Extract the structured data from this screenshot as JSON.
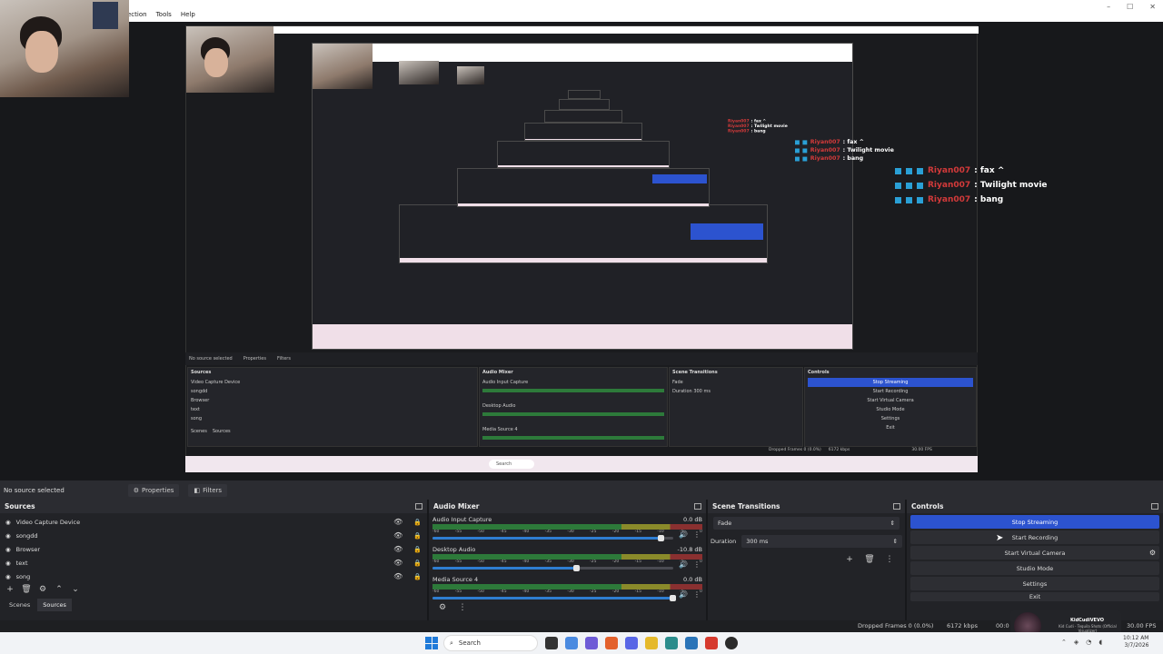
{
  "app": {
    "menu": [
      "ection",
      "Tools",
      "Help"
    ],
    "window_controls": [
      "–",
      "☐",
      "✕"
    ]
  },
  "preview": {
    "chat": [
      {
        "user": "Riyan007",
        "message": ": fax ^"
      },
      {
        "user": "Riyan007",
        "message": ": Twilight movie"
      },
      {
        "user": "Riyan007",
        "message": ": bang"
      }
    ],
    "inner": {
      "status": "No source selected",
      "properties": "Properties",
      "filters": "Filters",
      "sources_title": "Sources",
      "mixer_title": "Audio Mixer",
      "transitions_title": "Scene Transitions",
      "controls_title": "Controls",
      "sources": [
        "Video Capture Device",
        "songdd",
        "Browser",
        "text",
        "song"
      ],
      "stop_streaming": "Stop Streaming",
      "start_recording": "Start Recording",
      "virtual_camera": "Start Virtual Camera",
      "studio_mode": "Studio Mode",
      "settings": "Settings",
      "exit": "Exit",
      "fade": "Fade",
      "duration": "Duration",
      "duration_value": "300 ms",
      "scenes_tab": "Scenes",
      "sources_tab": "Sources",
      "mix_ch1": "Audio Input Capture",
      "mix_ch2": "Desktop Audio",
      "mix_ch3": "Media Source 4",
      "dropped": "Dropped Frames 0 (0.0%)",
      "kbps": "6172 kbps",
      "fps": "30.00 FPS",
      "search": "Search"
    }
  },
  "source_bar": {
    "label": "No source selected",
    "properties": "Properties",
    "filters": "Filters"
  },
  "sources": {
    "title": "Sources",
    "items": [
      "Video Capture Device",
      "songdd",
      "Browser",
      "text",
      "song"
    ],
    "tabs": [
      "Scenes",
      "Sources"
    ]
  },
  "mixer": {
    "title": "Audio Mixer",
    "ticks": [
      "-60",
      "-55",
      "-50",
      "-45",
      "-40",
      "-35",
      "-30",
      "-25",
      "-20",
      "-15",
      "-10",
      "-5",
      "0"
    ],
    "channels": [
      {
        "name": "Audio Input Capture",
        "db": "0.0 dB",
        "volume": 0.95
      },
      {
        "name": "Desktop Audio",
        "db": "-10.8 dB",
        "volume": 0.6
      },
      {
        "name": "Media Source 4",
        "db": "0.0 dB",
        "volume": 1.0
      }
    ]
  },
  "transitions": {
    "title": "Scene Transitions",
    "transition": "Fade",
    "duration_label": "Duration",
    "duration_value": "300 ms"
  },
  "controls": {
    "title": "Controls",
    "stop_streaming": "Stop Streaming",
    "start_recording": "Start Recording",
    "virtual_camera": "Start Virtual Camera",
    "studio_mode": "Studio Mode",
    "settings": "Settings",
    "exit": "Exit"
  },
  "status": {
    "dropped": "Dropped Frames 0 (0.0%)",
    "kbps": "6172 kbps",
    "time": "00:0",
    "fps": "30.00 FPS",
    "now_playing_title": "KidCudiVEVO",
    "now_playing_sub": "Kid Cudi - Tequila Shots (Official Visualizer)"
  },
  "taskbar": {
    "search": "Search",
    "time": "10:12 AM",
    "date": "3/7/2026"
  },
  "colors": {
    "accent": "#2c53cf",
    "chat_user": "#d33a3a",
    "meter_green": "#2d7a3a"
  }
}
